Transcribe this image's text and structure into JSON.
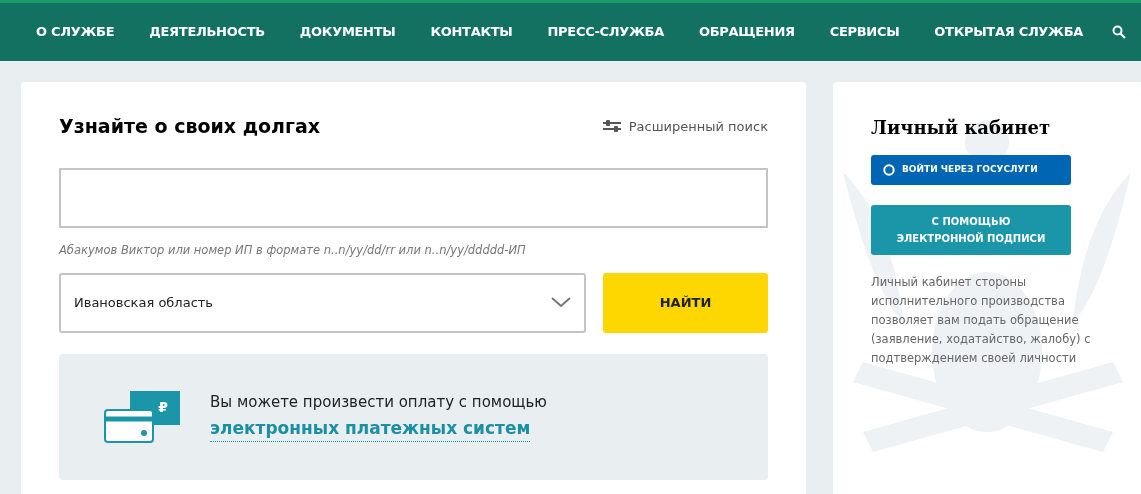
{
  "nav": {
    "items": [
      {
        "label": "О СЛУЖБЕ"
      },
      {
        "label": "ДЕЯТЕЛЬНОСТЬ"
      },
      {
        "label": "ДОКУМЕНТЫ"
      },
      {
        "label": "КОНТАКТЫ"
      },
      {
        "label": "ПРЕСС-СЛУЖБА"
      },
      {
        "label": "ОБРАЩЕНИЯ"
      },
      {
        "label": "СЕРВИСЫ"
      },
      {
        "label": "ОТКРЫТАЯ СЛУЖБА"
      }
    ]
  },
  "debt_search": {
    "title": "Узнайте о своих долгах",
    "advanced_link": "Расширенный поиск",
    "hint": "Абакумов Виктор или номер ИП в формате n..n/yy/dd/rr или n..n/yy/ddddd-ИП",
    "region": "Ивановская область",
    "submit": "НАЙТИ"
  },
  "payment": {
    "currency": "₽",
    "text": "Вы можете произвести оплату с помощью",
    "link": "электронных платежных систем"
  },
  "account": {
    "title": "Личный кабинет",
    "gosuslugi_button": "ВОЙТИ ЧЕРЕЗ ГОСУСЛУГИ",
    "signature_button": [
      "С ПОМОЩЬЮ",
      "ЭЛЕКТРОННОЙ ПОДПИСИ"
    ],
    "description": "Личный кабинет стороны исполнительного производства позволяет вам подать обращение (заявление, ходатайство, жалобу) с подтверждением своей личности"
  }
}
